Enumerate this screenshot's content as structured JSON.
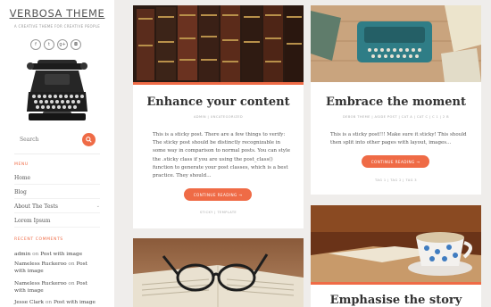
{
  "site": {
    "title": "VERBOSA THEME",
    "tagline": "A CREATIVE THEME FOR CREATIVE PEOPLE"
  },
  "social": [
    {
      "icon": "facebook-icon",
      "glyph": "f"
    },
    {
      "icon": "twitter-icon",
      "glyph": "t"
    },
    {
      "icon": "google-plus-icon",
      "glyph": "g+"
    },
    {
      "icon": "instagram-icon",
      "glyph": "◘"
    }
  ],
  "search": {
    "placeholder": "Search"
  },
  "menu": {
    "label": "MENU",
    "items": [
      {
        "label": "Home",
        "has_children": false
      },
      {
        "label": "Blog",
        "has_children": false
      },
      {
        "label": "About The Tests",
        "has_children": true
      },
      {
        "label": "Lorem Ipsum",
        "has_children": false
      }
    ]
  },
  "recent_comments": {
    "label": "RECENT COMMENTS",
    "items": [
      {
        "author": "admin",
        "on": "on",
        "post": "Post with image"
      },
      {
        "author": "Nameless Ruckeroo",
        "on": "on",
        "post": "Post with image"
      },
      {
        "author": "Nameless Ruckeroo",
        "on": "on",
        "post": "Post with image"
      },
      {
        "author": "Jesse Clark",
        "on": "on",
        "post": "Post with image"
      }
    ]
  },
  "posts": [
    {
      "title": "Enhance your content",
      "meta": "ADMIN   |   UNCATEGORIZED",
      "excerpt": [
        "This is a sticky post. There are a few things to verify:",
        "The sticky post should be distinctly recognizable in",
        "some way in comparison to normal posts. You can style",
        "the .sticky class if you are using the post_class()",
        "function to generate your post classes, which is a best",
        "practice. They should…"
      ],
      "button": "CONTINUE READING",
      "tags": "STICKY | TEMPLATE"
    },
    {
      "title": "Embrace the moment",
      "meta": "DEBOB THEME   |   ASIDE POST | CAT A | CAT C | C 1 | 2 B",
      "excerpt": [
        "This is a sticky post!!! Make sure it sticky! This should",
        "then split into other pages with layout, images…"
      ],
      "button": "CONTINUE READING",
      "tags": "TAG 1 | TAG 2 | TAG 3"
    },
    {
      "title": ""
    },
    {
      "title": "Emphasise the story"
    }
  ],
  "colors": {
    "accent": "#ef6b46",
    "background": "#efedeb"
  }
}
